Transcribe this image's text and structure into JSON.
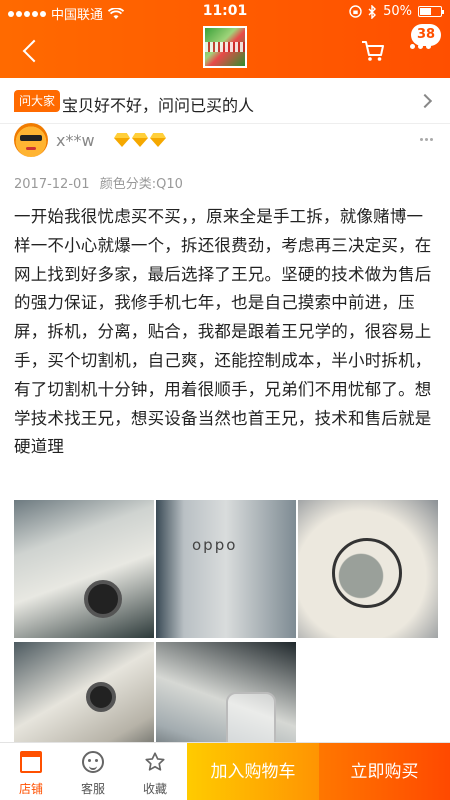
{
  "status_bar": {
    "carrier": "中国联通",
    "time": "11:01",
    "battery": "50%"
  },
  "nav": {
    "cart_count": "38"
  },
  "ask": {
    "tag": "问大家",
    "text": "宝贝好不好，问问已买的人"
  },
  "review": {
    "username": "x**w",
    "date": "2017-12-01",
    "variant": "颜色分类:Q10",
    "content": "一开始我很忧虑买不买，，原来全是手工拆，就像赌博一样一不小心就爆一个，拆还很费劲，考虑再三决定买，在网上找到好多家，最后选择了王兄。坚硬的技术做为售后的强力保证，我修手机七年，也是自己摸索中前进，压屏，拆机，分离，贴合，我都是跟着王兄学的，很容易上手，买个切割机，自己爽，还能控制成本，半小时拆机，有了切割机十分钟，用着很顺手，兄弟们不用忧郁了。想学技术找王兄，想买设备当然也首王兄，技术和售后就是硬道理",
    "photo_text": "oppo"
  },
  "bottom_bar": {
    "store": "店铺",
    "service": "客服",
    "favorite": "收藏",
    "add_to_cart": "加入购物车",
    "buy_now": "立即购买"
  },
  "colors": {
    "brand_orange": "#ff5000",
    "cart_yellow": "#ffb000"
  }
}
